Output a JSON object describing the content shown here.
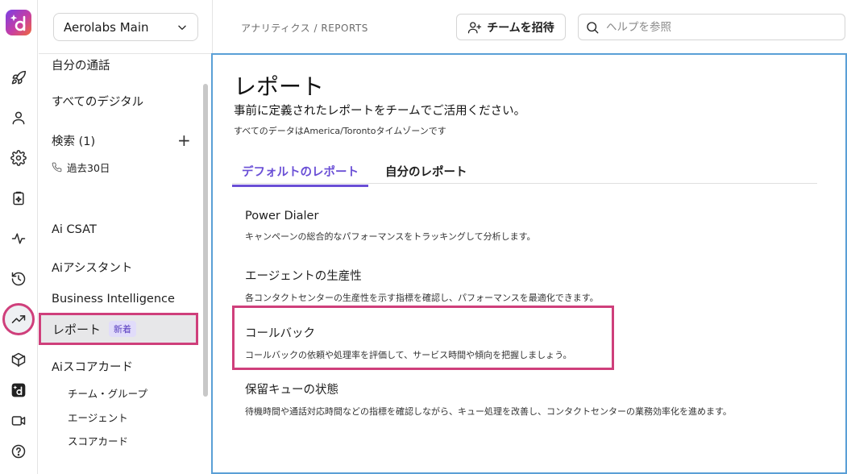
{
  "workspace": {
    "name": "Aerolabs Main"
  },
  "sidebar": {
    "items": [
      {
        "label": "自分の通話"
      },
      {
        "label": "すべてのデジタル"
      },
      {
        "label": "検索 (1)"
      },
      {
        "label": "過去30日"
      },
      {
        "label": "Ai CSAT"
      },
      {
        "label": "Aiアシスタント"
      },
      {
        "label": "Business Intelligence"
      },
      {
        "label": "レポート",
        "badge": "新着"
      },
      {
        "label": "Aiスコアカード"
      }
    ],
    "scorecard_sub": [
      {
        "label": "チーム・グループ"
      },
      {
        "label": "エージェント"
      },
      {
        "label": "スコアカード"
      }
    ],
    "search_add": "+"
  },
  "header": {
    "breadcrumb": "アナリティクス / REPORTS",
    "invite_label": "チームを招待",
    "help_placeholder": "ヘルプを参照"
  },
  "page": {
    "title": "レポート",
    "subtitle": "事前に定義されたレポートをチームでご活用ください。",
    "timezone_note": "すべてのデータはAmerica/Torontoタイムゾーンです",
    "tabs": [
      {
        "label": "デフォルトのレポート",
        "active": true
      },
      {
        "label": "自分のレポート",
        "active": false
      }
    ],
    "reports": [
      {
        "name": "Power Dialer",
        "desc": "キャンペーンの総合的なパフォーマンスをトラッキングして分析します。"
      },
      {
        "name": "エージェントの生産性",
        "desc": "各コンタクトセンターの生産性を示す指標を確認し、パフォーマンスを最適化できます。"
      },
      {
        "name": "コールバック",
        "desc": "コールバックの依頼や処理率を評価して、サービス時間や傾向を把握しましょう。",
        "highlighted": true
      },
      {
        "name": "保留キューの状態",
        "desc": "待機時間や通話対応時間などの指標を確認しながら、キュー処理を改善し、コンタクトセンターの業務効率化を進めます。"
      }
    ]
  },
  "colors": {
    "accent": "#6a4fd6",
    "highlight": "#cf3f7b",
    "focus_border": "#5a9fd6"
  },
  "rail_icons": [
    "rocket-icon",
    "user-icon",
    "gear-icon",
    "clipboard-sparkle-icon",
    "activity-icon",
    "history-icon",
    "trending-up-icon",
    "cube-icon",
    "app-logo-icon",
    "video-icon",
    "help-icon"
  ]
}
